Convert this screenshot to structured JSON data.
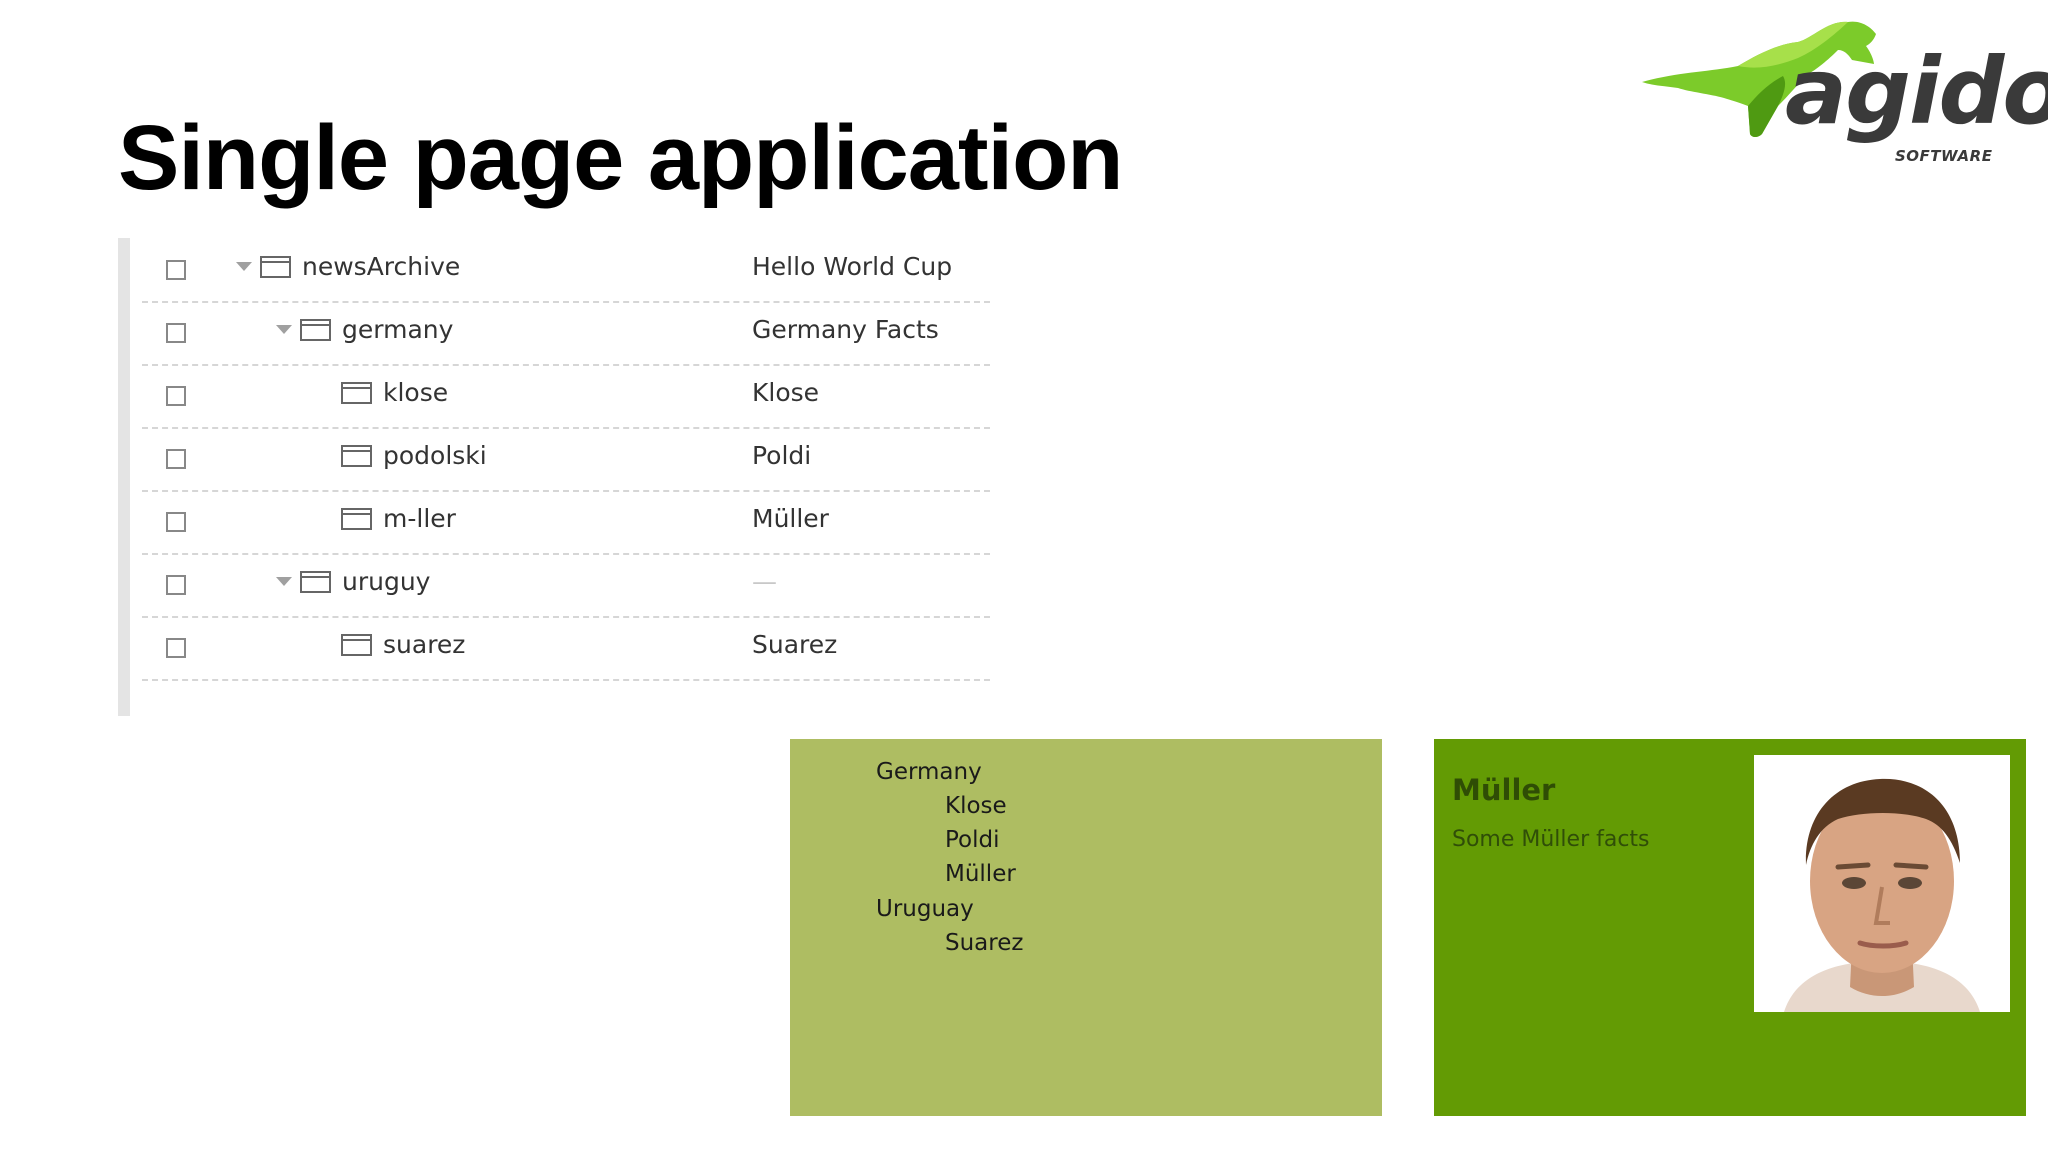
{
  "slide": {
    "title": "Single page application"
  },
  "logo": {
    "name": "agido",
    "tagline": "SOFTWARE"
  },
  "tree": {
    "rows": [
      {
        "label": "newsArchive",
        "title": "Hello World Cup",
        "depth": 0,
        "expandable": true
      },
      {
        "label": "germany",
        "title": "Germany Facts",
        "depth": 1,
        "expandable": true
      },
      {
        "label": "klose",
        "title": "Klose",
        "depth": 2,
        "expandable": false
      },
      {
        "label": "podolski",
        "title": "Poldi",
        "depth": 2,
        "expandable": false
      },
      {
        "label": "m-ller",
        "title": "Müller",
        "depth": 2,
        "expandable": false
      },
      {
        "label": "uruguy",
        "title": "—",
        "depth": 1,
        "expandable": true
      },
      {
        "label": "suarez",
        "title": "Suarez",
        "depth": 2,
        "expandable": false
      }
    ]
  },
  "nav": {
    "items": [
      {
        "label": "Germany",
        "level": 0
      },
      {
        "label": "Klose",
        "level": 1
      },
      {
        "label": "Poldi",
        "level": 1
      },
      {
        "label": "Müller",
        "level": 1
      },
      {
        "label": "Uruguay",
        "level": 0
      },
      {
        "label": "Suarez",
        "level": 1
      }
    ]
  },
  "detail": {
    "heading": "Müller",
    "text": "Some Müller facts"
  },
  "colors": {
    "nav_bg": "#aebd62",
    "detail_bg": "#639b04",
    "logo_green": "#6fc21d"
  }
}
